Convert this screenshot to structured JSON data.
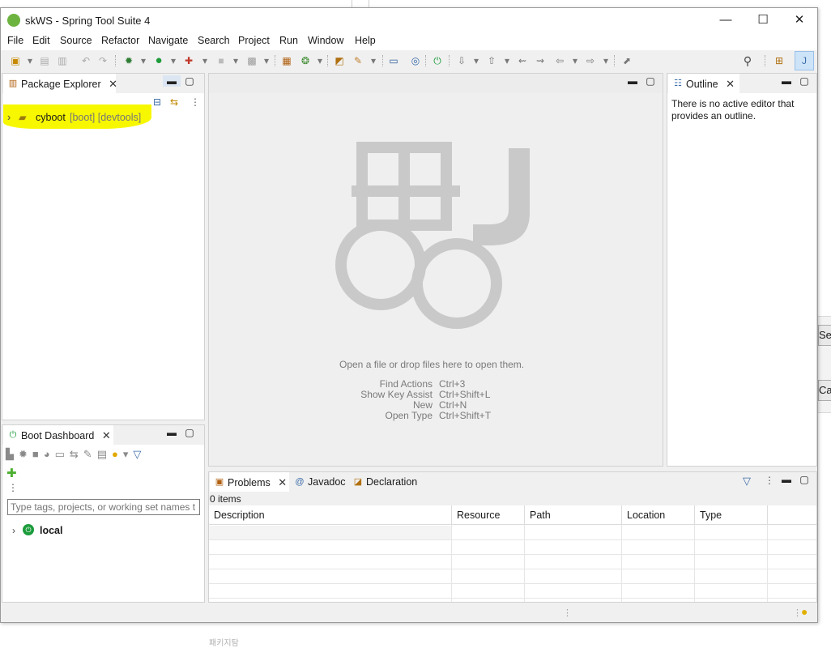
{
  "window": {
    "title": "skWS - Spring Tool Suite 4",
    "minimize": "—",
    "maximize": "☐",
    "close": "✕"
  },
  "menu": [
    "File",
    "Edit",
    "Source",
    "Refactor",
    "Navigate",
    "Search",
    "Project",
    "Run",
    "Window",
    "Help"
  ],
  "package_explorer": {
    "tab_label": "Package Explorer",
    "project": {
      "name": "cyboot",
      "decorations": "[boot] [devtools]"
    }
  },
  "editor": {
    "drop_hint": "Open a file or drop files here to open them.",
    "shortcuts": [
      {
        "label": "Find Actions",
        "key": "Ctrl+3"
      },
      {
        "label": "Show Key Assist",
        "key": "Ctrl+Shift+L"
      },
      {
        "label": "New",
        "key": "Ctrl+N"
      },
      {
        "label": "Open Type",
        "key": "Ctrl+Shift+T"
      }
    ]
  },
  "outline": {
    "tab_label": "Outline",
    "message": "There is no active editor that provides an outline."
  },
  "boot_dashboard": {
    "tab_label": "Boot Dashboard",
    "filter_placeholder": "Type tags, projects, or working set names t",
    "tree_item": "local"
  },
  "problems": {
    "tabs": [
      "Problems",
      "Javadoc",
      "Declaration"
    ],
    "count": "0 items",
    "columns": [
      "Description",
      "Resource",
      "Path",
      "Location",
      "Type"
    ]
  },
  "background_window": {
    "button1": "Se",
    "button2": "Car"
  },
  "bottom_text": "패키지탐",
  "colors": {
    "spring_green": "#6db33f",
    "highlight": "#f7f700",
    "boot_icon": "#1c9c3c"
  }
}
